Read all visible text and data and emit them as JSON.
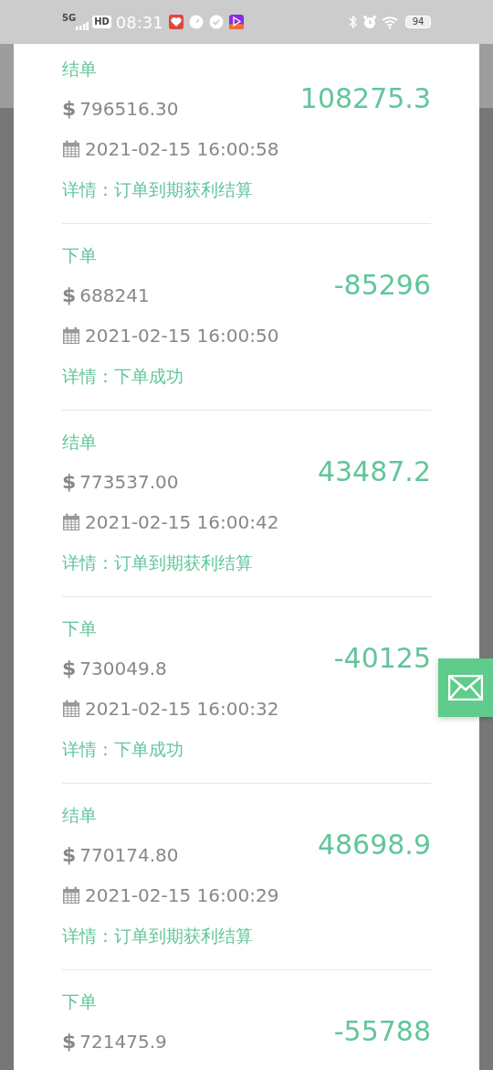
{
  "status_bar": {
    "network": "5G",
    "hd": "HD",
    "time": "08:31",
    "battery": "94"
  },
  "records": [
    {
      "type": "结单",
      "currency": "$",
      "amount": "796516.30",
      "value": "108275.3",
      "date": "2021-02-15 16:00:58",
      "detail": "详情：订单到期获利结算"
    },
    {
      "type": "下单",
      "currency": "$",
      "amount": "688241",
      "value": "-85296",
      "date": "2021-02-15 16:00:50",
      "detail": "详情：下单成功"
    },
    {
      "type": "结单",
      "currency": "$",
      "amount": "773537.00",
      "value": "43487.2",
      "date": "2021-02-15 16:00:42",
      "detail": "详情：订单到期获利结算"
    },
    {
      "type": "下单",
      "currency": "$",
      "amount": "730049.8",
      "value": "-40125",
      "date": "2021-02-15 16:00:32",
      "detail": "详情：下单成功"
    },
    {
      "type": "结单",
      "currency": "$",
      "amount": "770174.80",
      "value": "48698.9",
      "date": "2021-02-15 16:00:29",
      "detail": "详情：订单到期获利结算"
    },
    {
      "type": "下单",
      "currency": "$",
      "amount": "721475.9",
      "value": "-55788"
    }
  ]
}
